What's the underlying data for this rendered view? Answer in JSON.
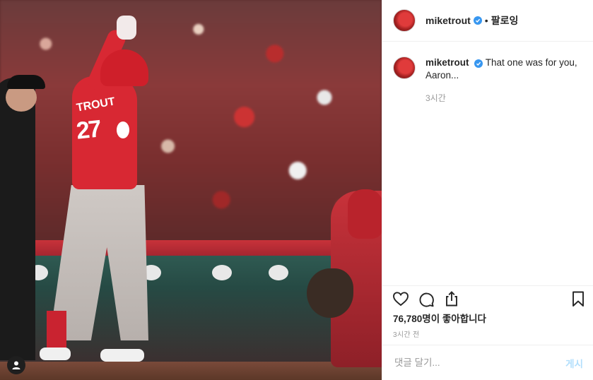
{
  "header": {
    "username": "miketrout",
    "separator": "•",
    "follow_label": "팔로잉"
  },
  "caption": {
    "username": "miketrout",
    "text": "That one was for you, Aaron...",
    "time": "3시간"
  },
  "stats": {
    "likes": "76,780명이 좋아합니다",
    "posted": "3시간 전"
  },
  "comment": {
    "placeholder": "댓글 달기...",
    "post_label": "게시"
  },
  "photo": {
    "player_name": "TROUT",
    "player_number": "27"
  },
  "colors": {
    "verified": "#3897f0",
    "post_button_disabled": "#b2dffc",
    "secondary_text": "#999999"
  },
  "icons": [
    "verified-icon",
    "heart-icon",
    "comment-icon",
    "share-icon",
    "bookmark-icon",
    "user-tag-icon"
  ]
}
